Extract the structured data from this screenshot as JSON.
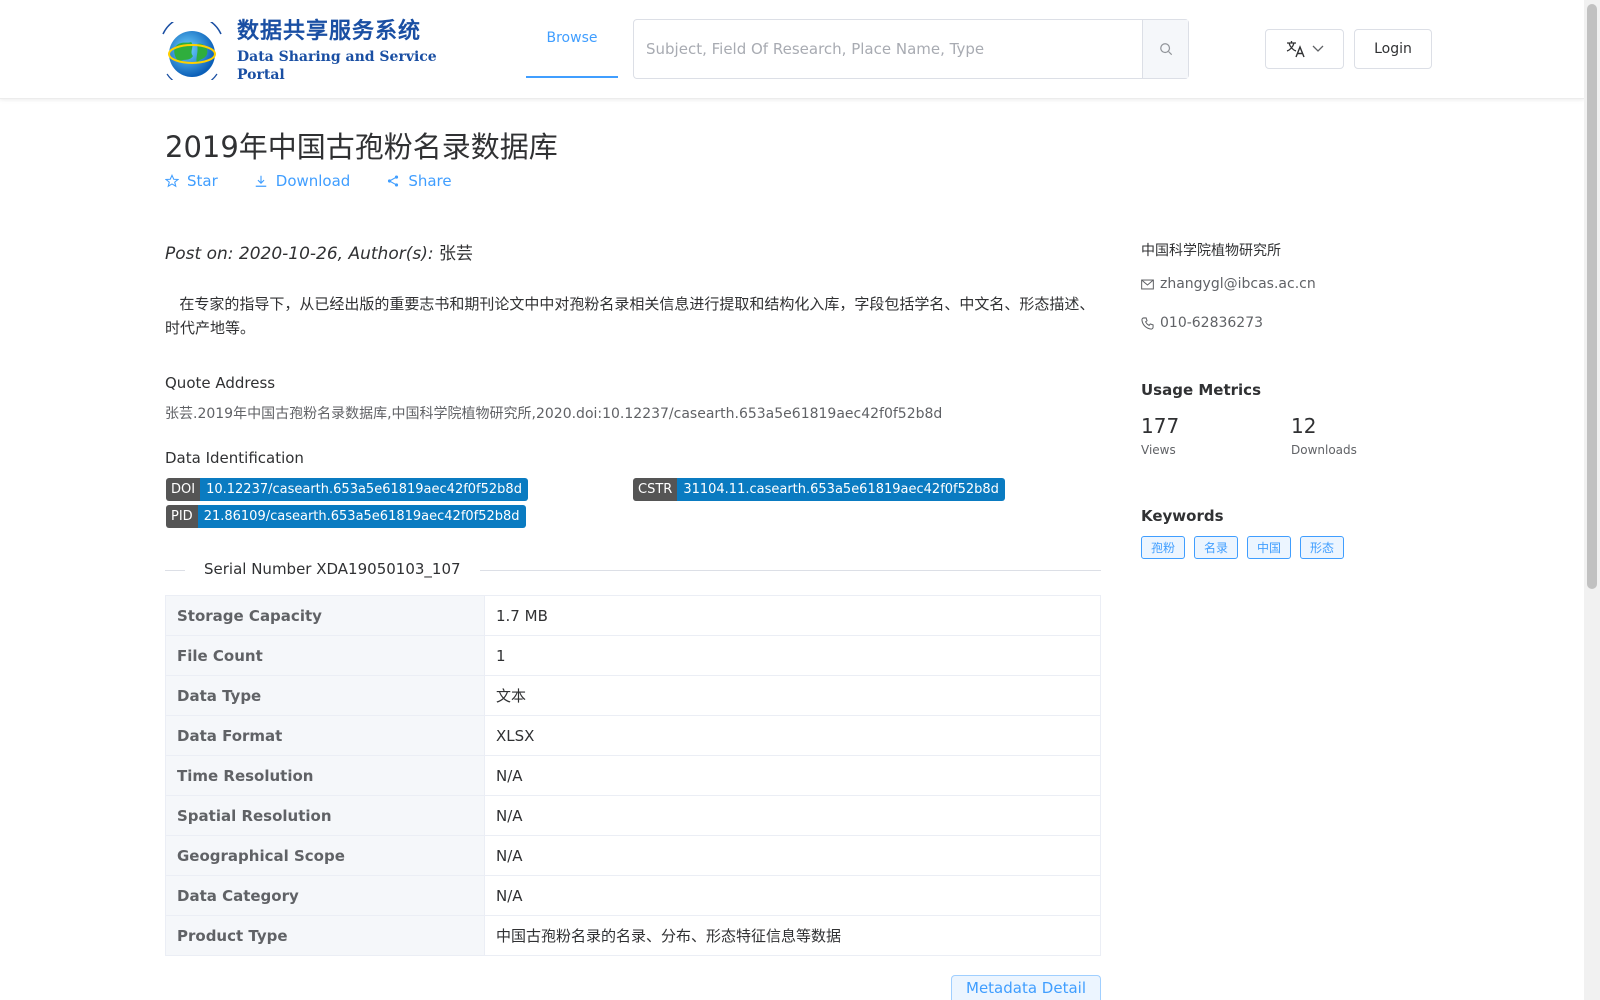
{
  "header": {
    "logo_cn": "数据共享服务系统",
    "logo_en": "Data Sharing and Service Portal",
    "nav_browse": "Browse",
    "search_placeholder": "Subject, Field Of Research, Place Name, Type",
    "login": "Login",
    "brand_color": "#1a4fa3",
    "accent_color": "#409eff"
  },
  "title": "2019年中国古孢粉名录数据库",
  "actions": {
    "star": "Star",
    "download": "Download",
    "share": "Share"
  },
  "post": {
    "prefix": "Post on: 2020-10-26, Author(s): ",
    "author": "张芸"
  },
  "description": "在专家的指导下，从已经出版的重要志书和期刊论文中中对孢粉名录相关信息进行提取和结构化入库，字段包括学名、中文名、形态描述、时代产地等。",
  "quote": {
    "label": "Quote Address",
    "text": "张芸.2019年中国古孢粉名录数据库,中国科学院植物研究所,2020.doi:10.12237/casearth.653a5e61819aec42f0f52b8d"
  },
  "identification": {
    "label": "Data Identification",
    "doi": {
      "k": "DOI",
      "v": "10.12237/casearth.653a5e61819aec42f0f52b8d"
    },
    "cstr": {
      "k": "CSTR",
      "v": "31104.11.casearth.653a5e61819aec42f0f52b8d"
    },
    "pid": {
      "k": "PID",
      "v": "21.86109/casearth.653a5e61819aec42f0f52b8d"
    }
  },
  "serial": "Serial Number XDA19050103_107",
  "table": [
    {
      "k": "Storage Capacity",
      "v": "1.7 MB"
    },
    {
      "k": "File Count",
      "v": "1"
    },
    {
      "k": "Data Type",
      "v": "文本"
    },
    {
      "k": "Data Format",
      "v": "XLSX"
    },
    {
      "k": "Time Resolution",
      "v": "N/A"
    },
    {
      "k": "Spatial Resolution",
      "v": "N/A"
    },
    {
      "k": "Geographical Scope",
      "v": "N/A"
    },
    {
      "k": "Data Category",
      "v": "N/A"
    },
    {
      "k": "Product Type",
      "v": "中国古孢粉名录的名录、分布、形态特征信息等数据"
    }
  ],
  "metadata_btn": "Metadata Detail",
  "sidebar": {
    "org": "中国科学院植物研究所",
    "email": "zhangygl@ibcas.ac.cn",
    "phone": "010-62836273",
    "usage_title": "Usage Metrics",
    "views": "177",
    "views_label": "Views",
    "downloads": "12",
    "downloads_label": "Downloads",
    "keywords_title": "Keywords",
    "keywords": [
      "孢粉",
      "名录",
      "中国",
      "形态"
    ]
  }
}
